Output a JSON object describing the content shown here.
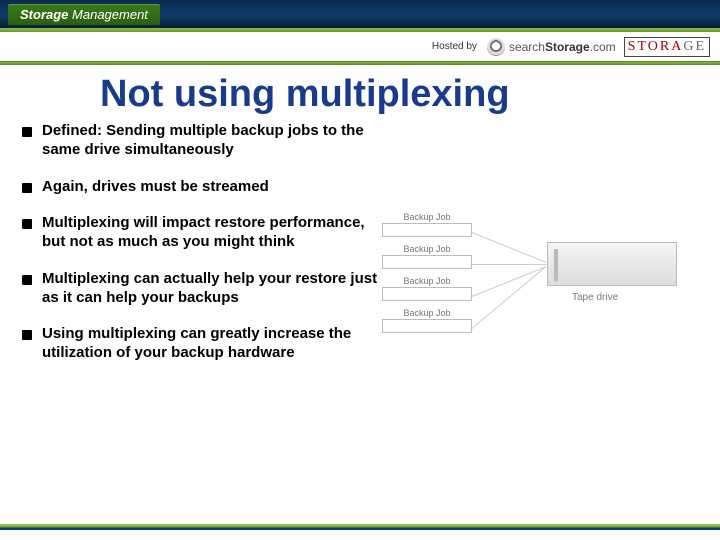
{
  "brand": {
    "bold": "Storage",
    "light": "Management"
  },
  "hosted": {
    "label": "Hosted by",
    "search_prefix": "search",
    "search_bold": "Storage",
    "search_suffix": ".com",
    "storage_red": "STORA",
    "storage_grey": "GE"
  },
  "title": "Not using multiplexing",
  "bullets": [
    "Defined: Sending multiple backup jobs to the same drive simultaneously",
    "Again, drives must be streamed",
    "Multiplexing will impact restore performance, but not as much as you might think",
    "Multiplexing can actually help your restore just as it can help your backups",
    "Using multiplexing can greatly increase the utilization of your backup hardware"
  ],
  "diagram": {
    "job_label": "Backup Job",
    "tape_label": "Tape drive"
  }
}
